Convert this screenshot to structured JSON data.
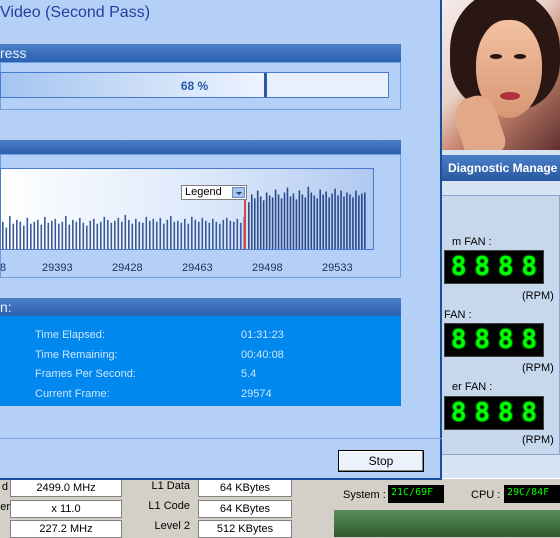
{
  "window": {
    "title": "Video (Second Pass)",
    "progress_group_title": "ress",
    "progress_percent": 68,
    "progress_text": "68 %",
    "stats_group_title": "n:",
    "stop_label": "Stop"
  },
  "chart_data": {
    "type": "bar",
    "legend_label": "Legend",
    "x_ticks": [
      "8",
      "29393",
      "29428",
      "29463",
      "29498",
      "29533"
    ],
    "marker_frame": 29474,
    "bar_values_before_marker": [
      30,
      24,
      36,
      28,
      32,
      30,
      26,
      34,
      28,
      30,
      32,
      27,
      35,
      29,
      31,
      33,
      28,
      30,
      36,
      27,
      32,
      30,
      34,
      29,
      26,
      31,
      33,
      28,
      30,
      35,
      32,
      29,
      31,
      34,
      30,
      37,
      32,
      28,
      33,
      30,
      29,
      35,
      31,
      33,
      30,
      34,
      28,
      32,
      36,
      30,
      31,
      29,
      33,
      28,
      35,
      32,
      30,
      34,
      31,
      29,
      33,
      30,
      28,
      32,
      34,
      31,
      30,
      33,
      29,
      35
    ],
    "bar_values_after_marker": [
      50,
      58,
      54,
      62,
      56,
      52,
      60,
      57,
      55,
      63,
      58,
      54,
      60,
      65,
      56,
      59,
      53,
      62,
      58,
      55,
      66,
      60,
      57,
      54,
      63,
      58,
      61,
      55,
      59,
      64,
      57,
      62,
      56,
      60,
      58,
      55,
      62,
      57,
      59,
      60
    ]
  },
  "stats": [
    {
      "label": "Time Elapsed:",
      "value": "01:31:23"
    },
    {
      "label": "Time Remaining:",
      "value": "00:40:08"
    },
    {
      "label": "Frames Per Second:",
      "value": "5.4"
    },
    {
      "label": "Current Frame:",
      "value": "29574"
    }
  ],
  "diagnostic": {
    "title": "Diagnostic Manage",
    "fans": [
      {
        "label": "m FAN :",
        "digits": [
          "8",
          "8",
          "8",
          "8"
        ],
        "unit": "(RPM)"
      },
      {
        "label": "FAN :",
        "digits": [
          "8",
          "8",
          "8",
          "8"
        ],
        "unit": "(RPM)"
      },
      {
        "label": "er FAN :",
        "digits": [
          "8",
          "8",
          "8",
          "8"
        ],
        "unit": "(RPM)"
      }
    ],
    "system_label": "System :",
    "system_value": "21C/69F",
    "cpu_label": "CPU :",
    "cpu_value": "29C/84F"
  },
  "cpu_info": {
    "left_labels": [
      "d",
      "er",
      ""
    ],
    "left_values": [
      "2499.0 MHz",
      "x 11.0",
      "227.2 MHz"
    ],
    "cache_labels": [
      "L1 Data",
      "L1 Code",
      "Level 2"
    ],
    "cache_values": [
      "64 KBytes",
      "64 KBytes",
      "512 KBytes"
    ]
  },
  "colors": {
    "window_bg": "#b4d0f6",
    "group_header": "#2c60b0",
    "stats_bg": "#0088ee",
    "lcd_green": "#00ff00",
    "marker_red": "#e04040"
  }
}
